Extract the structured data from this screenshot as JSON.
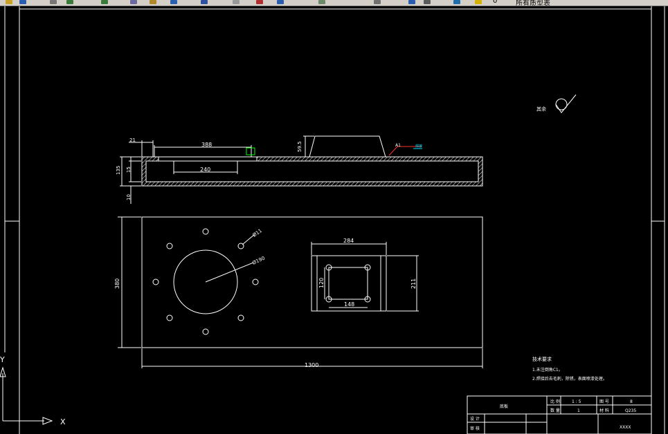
{
  "toolbar": {
    "layer_text": "0",
    "style_text": "所有质型表",
    "icons": [
      "open-icon",
      "save-icon",
      "print-icon",
      "undo-icon",
      "redo-icon",
      "pan-icon",
      "zoom-icon",
      "zoom-window-icon",
      "properties-icon",
      "design-center-icon",
      "table-icon",
      "help-icon",
      "layer-icon",
      "light-icon",
      "freeze-icon"
    ]
  },
  "drawing": {
    "dims": {
      "d21": "21",
      "d388": "388",
      "d135": "135",
      "d15": "15",
      "d10": "10",
      "d240": "240",
      "d59_5": "59.5",
      "d380": "380",
      "d1300": "1300",
      "d284": "284",
      "d211": "211",
      "d120": "120",
      "d148": "148",
      "dia11": "Ø11",
      "dia190": "Ø190"
    },
    "weld_label": "A1",
    "weld_note": "焊接",
    "surface_label": "其余",
    "notes": {
      "title": "技术要求",
      "line1": "1.未注倒角C1。",
      "line2": "2.焊接后去毛刺，除锈，表面喷漆处理。"
    }
  },
  "title_block": {
    "scale_label": "比 例",
    "scale_value": "1 : 5",
    "drawing_no_label": "图 号",
    "drawing_no_value": "8",
    "qty_label": "数 量",
    "qty_value": "1",
    "material_label": "材 料",
    "material_value": "Q235",
    "designer_label": "设 计",
    "checker_label": "审 核",
    "name_value": "底板",
    "company_value": "XXXX"
  },
  "ucs": {
    "x_label": "X",
    "y_label": "Y"
  }
}
